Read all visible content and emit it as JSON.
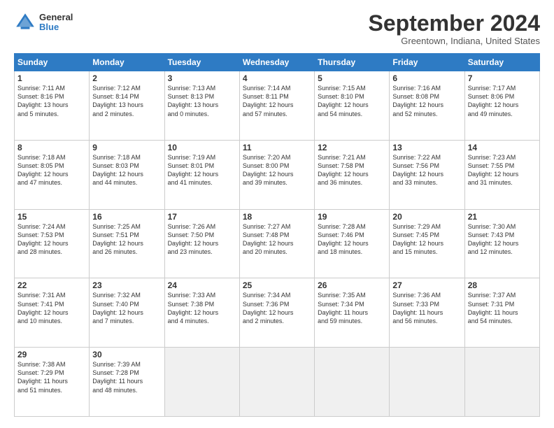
{
  "header": {
    "logo_general": "General",
    "logo_blue": "Blue",
    "month_title": "September 2024",
    "location": "Greentown, Indiana, United States"
  },
  "weekdays": [
    "Sunday",
    "Monday",
    "Tuesday",
    "Wednesday",
    "Thursday",
    "Friday",
    "Saturday"
  ],
  "weeks": [
    [
      {
        "day": "1",
        "lines": [
          "Sunrise: 7:11 AM",
          "Sunset: 8:16 PM",
          "Daylight: 13 hours",
          "and 5 minutes."
        ]
      },
      {
        "day": "2",
        "lines": [
          "Sunrise: 7:12 AM",
          "Sunset: 8:14 PM",
          "Daylight: 13 hours",
          "and 2 minutes."
        ]
      },
      {
        "day": "3",
        "lines": [
          "Sunrise: 7:13 AM",
          "Sunset: 8:13 PM",
          "Daylight: 13 hours",
          "and 0 minutes."
        ]
      },
      {
        "day": "4",
        "lines": [
          "Sunrise: 7:14 AM",
          "Sunset: 8:11 PM",
          "Daylight: 12 hours",
          "and 57 minutes."
        ]
      },
      {
        "day": "5",
        "lines": [
          "Sunrise: 7:15 AM",
          "Sunset: 8:10 PM",
          "Daylight: 12 hours",
          "and 54 minutes."
        ]
      },
      {
        "day": "6",
        "lines": [
          "Sunrise: 7:16 AM",
          "Sunset: 8:08 PM",
          "Daylight: 12 hours",
          "and 52 minutes."
        ]
      },
      {
        "day": "7",
        "lines": [
          "Sunrise: 7:17 AM",
          "Sunset: 8:06 PM",
          "Daylight: 12 hours",
          "and 49 minutes."
        ]
      }
    ],
    [
      {
        "day": "8",
        "lines": [
          "Sunrise: 7:18 AM",
          "Sunset: 8:05 PM",
          "Daylight: 12 hours",
          "and 47 minutes."
        ]
      },
      {
        "day": "9",
        "lines": [
          "Sunrise: 7:18 AM",
          "Sunset: 8:03 PM",
          "Daylight: 12 hours",
          "and 44 minutes."
        ]
      },
      {
        "day": "10",
        "lines": [
          "Sunrise: 7:19 AM",
          "Sunset: 8:01 PM",
          "Daylight: 12 hours",
          "and 41 minutes."
        ]
      },
      {
        "day": "11",
        "lines": [
          "Sunrise: 7:20 AM",
          "Sunset: 8:00 PM",
          "Daylight: 12 hours",
          "and 39 minutes."
        ]
      },
      {
        "day": "12",
        "lines": [
          "Sunrise: 7:21 AM",
          "Sunset: 7:58 PM",
          "Daylight: 12 hours",
          "and 36 minutes."
        ]
      },
      {
        "day": "13",
        "lines": [
          "Sunrise: 7:22 AM",
          "Sunset: 7:56 PM",
          "Daylight: 12 hours",
          "and 33 minutes."
        ]
      },
      {
        "day": "14",
        "lines": [
          "Sunrise: 7:23 AM",
          "Sunset: 7:55 PM",
          "Daylight: 12 hours",
          "and 31 minutes."
        ]
      }
    ],
    [
      {
        "day": "15",
        "lines": [
          "Sunrise: 7:24 AM",
          "Sunset: 7:53 PM",
          "Daylight: 12 hours",
          "and 28 minutes."
        ]
      },
      {
        "day": "16",
        "lines": [
          "Sunrise: 7:25 AM",
          "Sunset: 7:51 PM",
          "Daylight: 12 hours",
          "and 26 minutes."
        ]
      },
      {
        "day": "17",
        "lines": [
          "Sunrise: 7:26 AM",
          "Sunset: 7:50 PM",
          "Daylight: 12 hours",
          "and 23 minutes."
        ]
      },
      {
        "day": "18",
        "lines": [
          "Sunrise: 7:27 AM",
          "Sunset: 7:48 PM",
          "Daylight: 12 hours",
          "and 20 minutes."
        ]
      },
      {
        "day": "19",
        "lines": [
          "Sunrise: 7:28 AM",
          "Sunset: 7:46 PM",
          "Daylight: 12 hours",
          "and 18 minutes."
        ]
      },
      {
        "day": "20",
        "lines": [
          "Sunrise: 7:29 AM",
          "Sunset: 7:45 PM",
          "Daylight: 12 hours",
          "and 15 minutes."
        ]
      },
      {
        "day": "21",
        "lines": [
          "Sunrise: 7:30 AM",
          "Sunset: 7:43 PM",
          "Daylight: 12 hours",
          "and 12 minutes."
        ]
      }
    ],
    [
      {
        "day": "22",
        "lines": [
          "Sunrise: 7:31 AM",
          "Sunset: 7:41 PM",
          "Daylight: 12 hours",
          "and 10 minutes."
        ]
      },
      {
        "day": "23",
        "lines": [
          "Sunrise: 7:32 AM",
          "Sunset: 7:40 PM",
          "Daylight: 12 hours",
          "and 7 minutes."
        ]
      },
      {
        "day": "24",
        "lines": [
          "Sunrise: 7:33 AM",
          "Sunset: 7:38 PM",
          "Daylight: 12 hours",
          "and 4 minutes."
        ]
      },
      {
        "day": "25",
        "lines": [
          "Sunrise: 7:34 AM",
          "Sunset: 7:36 PM",
          "Daylight: 12 hours",
          "and 2 minutes."
        ]
      },
      {
        "day": "26",
        "lines": [
          "Sunrise: 7:35 AM",
          "Sunset: 7:34 PM",
          "Daylight: 11 hours",
          "and 59 minutes."
        ]
      },
      {
        "day": "27",
        "lines": [
          "Sunrise: 7:36 AM",
          "Sunset: 7:33 PM",
          "Daylight: 11 hours",
          "and 56 minutes."
        ]
      },
      {
        "day": "28",
        "lines": [
          "Sunrise: 7:37 AM",
          "Sunset: 7:31 PM",
          "Daylight: 11 hours",
          "and 54 minutes."
        ]
      }
    ],
    [
      {
        "day": "29",
        "lines": [
          "Sunrise: 7:38 AM",
          "Sunset: 7:29 PM",
          "Daylight: 11 hours",
          "and 51 minutes."
        ]
      },
      {
        "day": "30",
        "lines": [
          "Sunrise: 7:39 AM",
          "Sunset: 7:28 PM",
          "Daylight: 11 hours",
          "and 48 minutes."
        ]
      },
      {
        "day": "",
        "lines": []
      },
      {
        "day": "",
        "lines": []
      },
      {
        "day": "",
        "lines": []
      },
      {
        "day": "",
        "lines": []
      },
      {
        "day": "",
        "lines": []
      }
    ]
  ]
}
